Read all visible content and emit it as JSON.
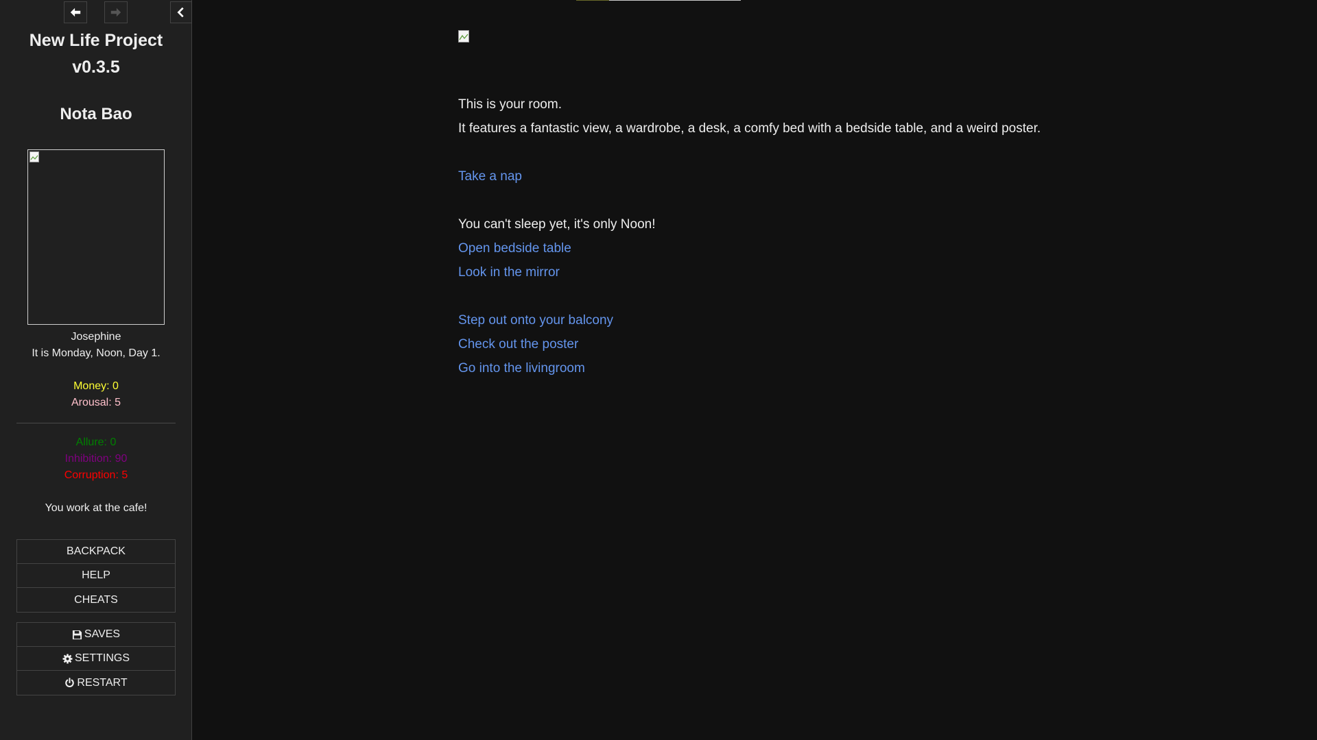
{
  "sidebar": {
    "title_line1": "New Life Project",
    "title_line2": "v0.3.5",
    "character_name": "Nota Bao",
    "portrait_name": "Josephine",
    "time_text": "It is Monday, Noon, Day 1.",
    "stats": {
      "money": "Money: 0",
      "arousal": "Arousal: 5",
      "allure": "Allure: 0",
      "inhibition": "Inhibition: 90",
      "corruption": "Corruption: 5"
    },
    "job_text": "You work at the cafe!",
    "menu": {
      "backpack": "BACKPACK",
      "help": "HELP",
      "cheats": "CHEATS"
    },
    "system_menu": {
      "saves": "SAVES",
      "settings": "SETTINGS",
      "restart": "RESTART"
    }
  },
  "colors": {
    "money": "#ffff33",
    "arousal": "#ffc0cb",
    "allure": "#008000",
    "inhibition": "#800080",
    "corruption": "#ff0000",
    "link": "#6495ed"
  },
  "passage": {
    "intro_line1": "This is your room.",
    "intro_line2": "It features a fantastic view, a wardrobe, a desk, a comfy bed with a bedside table, and a weird poster.",
    "link_nap": "Take a nap",
    "sleep_notice": "You can't sleep yet, it's only Noon!",
    "link_bedside": "Open bedside table",
    "link_mirror": "Look in the mirror",
    "link_balcony": "Step out onto your balcony",
    "link_poster": "Check out the poster",
    "link_livingroom": "Go into the livingroom"
  }
}
